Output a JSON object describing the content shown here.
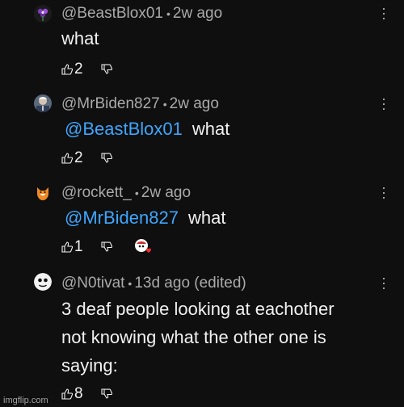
{
  "comments": [
    {
      "handle": "@BeastBlox01",
      "separator": "•",
      "time": "2w ago",
      "mention": "",
      "text": "what",
      "likes": "2",
      "avatar_icon": "purple-flower-avatar"
    },
    {
      "handle": "@MrBiden827",
      "separator": "•",
      "time": "2w ago",
      "mention": "@BeastBlox01",
      "text": "what",
      "likes": "2",
      "avatar_icon": "person-photo-avatar"
    },
    {
      "handle": "@rockett_",
      "separator": "•",
      "time": "2w ago",
      "mention": "@MrBiden827",
      "text": "what",
      "likes": "1",
      "avatar_icon": "orange-cat-avatar",
      "creator_heart": true
    },
    {
      "handle": "@N0tivat",
      "separator": "•",
      "time": "13d ago (edited)",
      "mention": "",
      "text_lines": [
        "3 deaf people looking at eachother",
        "not knowing what the other one is",
        "saying:"
      ],
      "likes": "8",
      "avatar_icon": "white-face-avatar"
    }
  ],
  "watermark": "imgflip.com",
  "colors": {
    "background": "#0f0f0f",
    "mention": "#3ea6ff",
    "meta": "#aaaaaa",
    "text": "#f1f1f1"
  }
}
